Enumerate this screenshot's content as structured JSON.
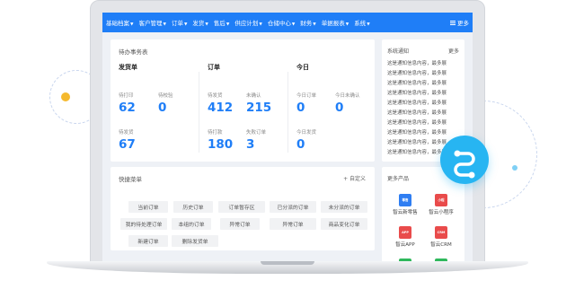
{
  "nav": {
    "items": [
      "基础档案",
      "客户管理",
      "订单",
      "发货",
      "售后",
      "供应计划",
      "仓储中心",
      "财务",
      "单据报表",
      "系统"
    ],
    "more": "更多"
  },
  "todo": {
    "title": "待办事务表",
    "columns": [
      {
        "title": "发货单",
        "stats": [
          {
            "label": "待打印",
            "value": "62"
          },
          {
            "label": "待校验",
            "value": "0"
          },
          {
            "label": "待发货",
            "value": "67"
          }
        ]
      },
      {
        "title": "订单",
        "stats": [
          {
            "label": "待发货",
            "value": "412"
          },
          {
            "label": "未确认",
            "value": "215"
          },
          {
            "label": "待打款",
            "value": "180"
          },
          {
            "label": "失败订单",
            "value": "3"
          }
        ]
      },
      {
        "title": "今日",
        "stats": [
          {
            "label": "今日订单",
            "value": "0"
          },
          {
            "label": "今日未确认",
            "value": "0"
          },
          {
            "label": "今日发货",
            "value": "0"
          }
        ]
      }
    ]
  },
  "shortcut": {
    "title": "快捷菜单",
    "add": "+ 自定义",
    "rows": [
      [
        "当前订单",
        "历史订单",
        "订单暂存区",
        "已分派的订单",
        "未分派的订单"
      ],
      [
        "我的待处理订单",
        "本组的订单",
        "异常订单",
        "异常订单",
        "商品变化订单"
      ],
      [
        "新建订单",
        "删除发货单"
      ]
    ]
  },
  "notice": {
    "title": "系统通知",
    "more": "更多",
    "items": [
      "这是通知信息内容，最多展",
      "这是通知信息内容，最多展",
      "这是通知信息内容，最多展",
      "这是通知信息内容，最多展",
      "这是通知信息内容，最多展",
      "这是通知信息内容，最多展",
      "这是通知信息内容，最多展",
      "这是通知信息内容，最多展",
      "这是通知信息内容，最多展",
      "这是通知信息内容，最多展"
    ]
  },
  "products": {
    "title": "更多产品",
    "items": [
      {
        "label": "智云新零售",
        "badge": "零售",
        "color": "#2f7ef2",
        "icon": "retail-icon"
      },
      {
        "label": "智云小程序",
        "badge": "小程",
        "color": "#e94b4b",
        "icon": "mini-program-icon"
      },
      {
        "label": "智云APP",
        "badge": "APP",
        "color": "#e94b4b",
        "icon": "thumbs-up-icon"
      },
      {
        "label": "智云CRM",
        "badge": "CRM",
        "color": "#e94b4b",
        "icon": "crm-icon"
      },
      {
        "label": "",
        "badge": "",
        "color": "#2fb85c",
        "icon": "green-app-icon"
      },
      {
        "label": "",
        "badge": "",
        "color": "#2fb85c",
        "icon": "green-app-icon-2"
      }
    ]
  },
  "colors": {
    "accent": "#1f7ef7",
    "badge": "#27b5f2",
    "orange_dot": "#f5b92e"
  }
}
